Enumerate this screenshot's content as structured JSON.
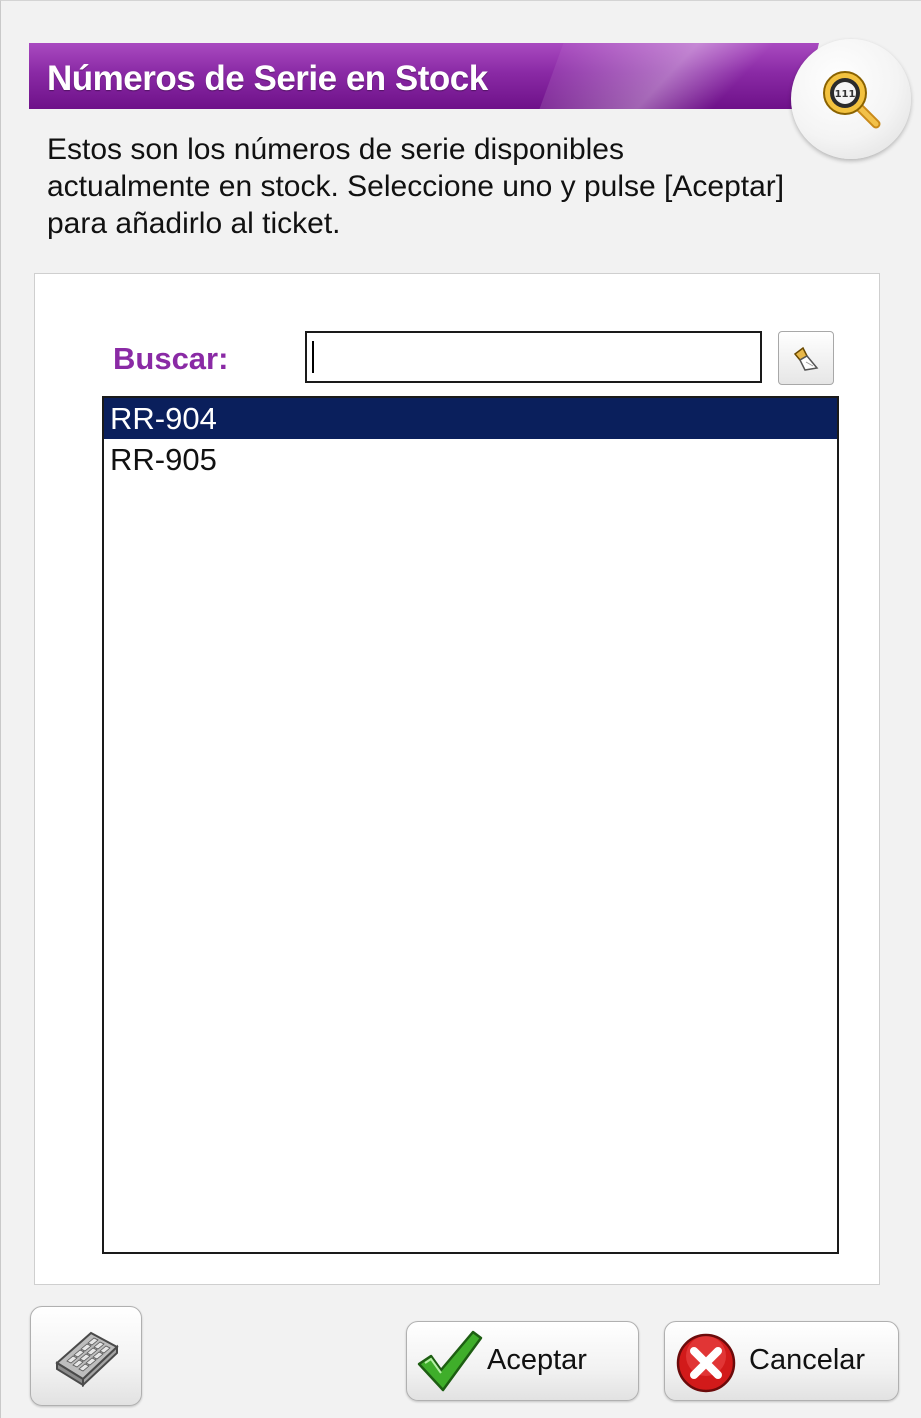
{
  "dialog": {
    "title": "Números de Serie en Stock",
    "title_icon": "serial-search-icon",
    "description": "Estos son los números de serie disponibles actualmente en stock. Seleccione uno y pulse [Aceptar] para añadirlo al ticket."
  },
  "search": {
    "label": "Buscar:",
    "value": "",
    "clear_icon": "eraser-icon"
  },
  "serial_list": {
    "items": [
      {
        "label": "RR-904",
        "selected": true
      },
      {
        "label": "RR-905",
        "selected": false
      }
    ]
  },
  "footer": {
    "keyboard_icon": "keyboard-icon",
    "ok_label": "Aceptar",
    "ok_icon": "checkmark-icon",
    "cancel_label": "Cancelar",
    "cancel_icon": "cancel-x-icon"
  },
  "colors": {
    "accent_purple": "#8a2aa5",
    "selection_navy": "#0a1f5c",
    "ok_green": "#2e9a1e",
    "cancel_red": "#d21a1a"
  }
}
